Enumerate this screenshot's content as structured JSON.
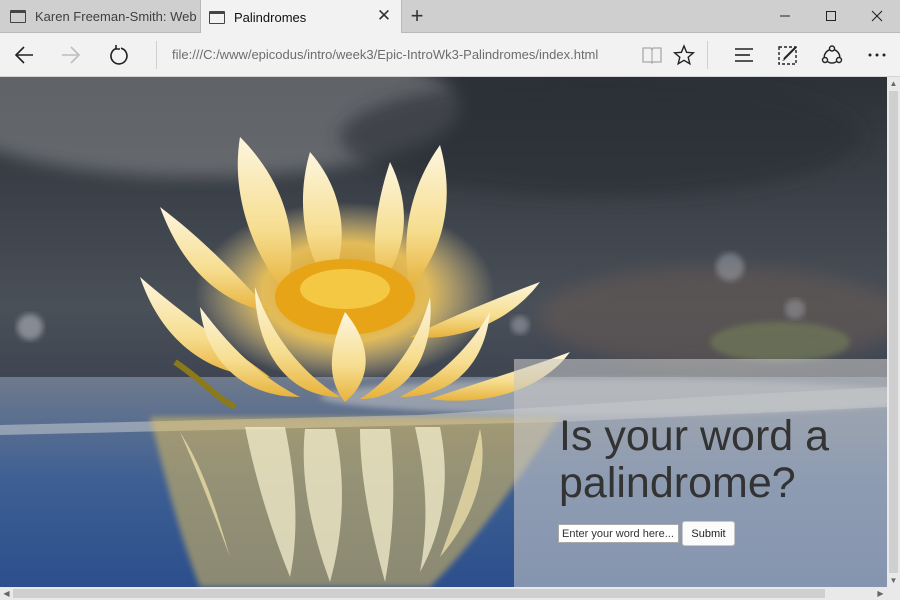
{
  "tabs": [
    {
      "title": "Karen Freeman-Smith: Web",
      "active": false
    },
    {
      "title": "Palindromes",
      "active": true
    }
  ],
  "toolbar": {
    "address": "file:///C:/www/epicodus/intro/week3/Epic-IntroWk3-Palindromes/index.html"
  },
  "page": {
    "heading": "Is your word a palindrome?",
    "input_placeholder": "Enter your word here...",
    "submit_label": "Submit"
  },
  "icons": {
    "tab_close": "close-icon",
    "new_tab": "plus-icon",
    "back": "arrow-left-icon",
    "forward": "arrow-right-icon",
    "refresh": "refresh-icon",
    "reading_view": "book-icon",
    "favorite": "star-icon",
    "hub": "hub-icon",
    "web_note": "pen-icon",
    "share": "share-icon",
    "more": "more-icon"
  },
  "colors": {
    "tab_strip": "#cfcfcf",
    "toolbar": "#f2f2f2",
    "heading_text": "#333333",
    "panel_overlay": "rgba(200,200,200,0.58)"
  }
}
